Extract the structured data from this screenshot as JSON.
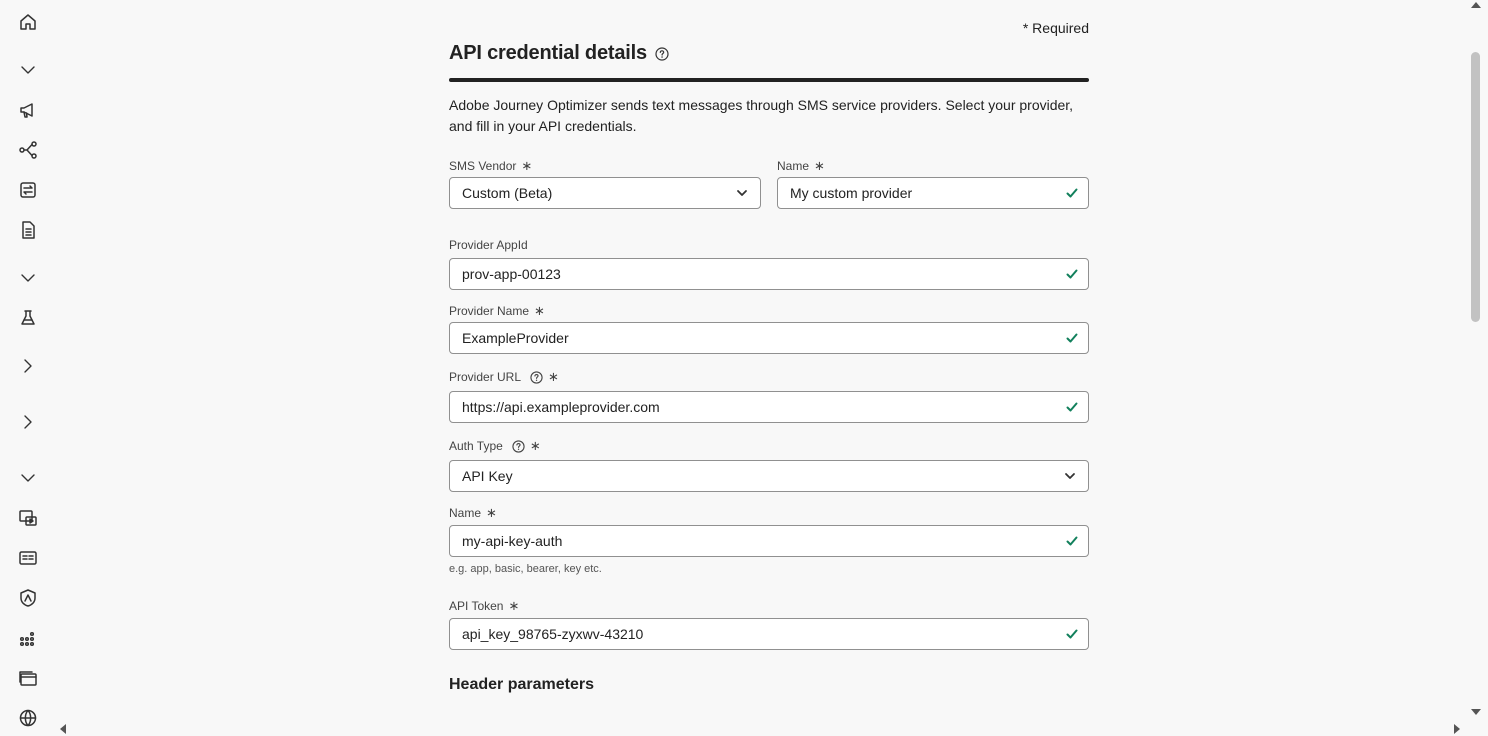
{
  "required_note": "* Required",
  "title": "API credential details",
  "intro": "Adobe Journey Optimizer sends text messages through SMS service providers. Select your provider, and fill in your API credentials.",
  "required_marker": "∗",
  "fields": {
    "sms_vendor": {
      "label": "SMS Vendor",
      "value": "Custom (Beta)"
    },
    "name": {
      "label": "Name",
      "value": "My custom provider"
    },
    "provider_appid": {
      "label": "Provider AppId",
      "value": "prov-app-00123"
    },
    "provider_name": {
      "label": "Provider Name",
      "value": "ExampleProvider"
    },
    "provider_url": {
      "label": "Provider URL",
      "value": "https://api.exampleprovider.com"
    },
    "auth_type": {
      "label": "Auth Type",
      "value": "API Key"
    },
    "auth_name": {
      "label": "Name",
      "value": "my-api-key-auth",
      "hint": "e.g. app, basic, bearer, key etc."
    },
    "api_token": {
      "label": "API Token",
      "value": "api_key_98765-zyxwv-43210"
    }
  },
  "header_parameters_title": "Header parameters",
  "colors": {
    "valid": "#12805c",
    "rule": "#222222",
    "border": "#909090"
  },
  "rail_icons": [
    "home-icon",
    "chevron-down-icon",
    "megaphone-icon",
    "journey-icon",
    "content-exchange-icon",
    "document-icon",
    "chevron-down-icon",
    "flask-icon",
    "chevron-right-icon",
    "chevron-right-icon",
    "chevron-down-icon",
    "media-icon",
    "card-icon",
    "shield-icon",
    "apps-icon",
    "folders-icon",
    "globe-icon"
  ]
}
